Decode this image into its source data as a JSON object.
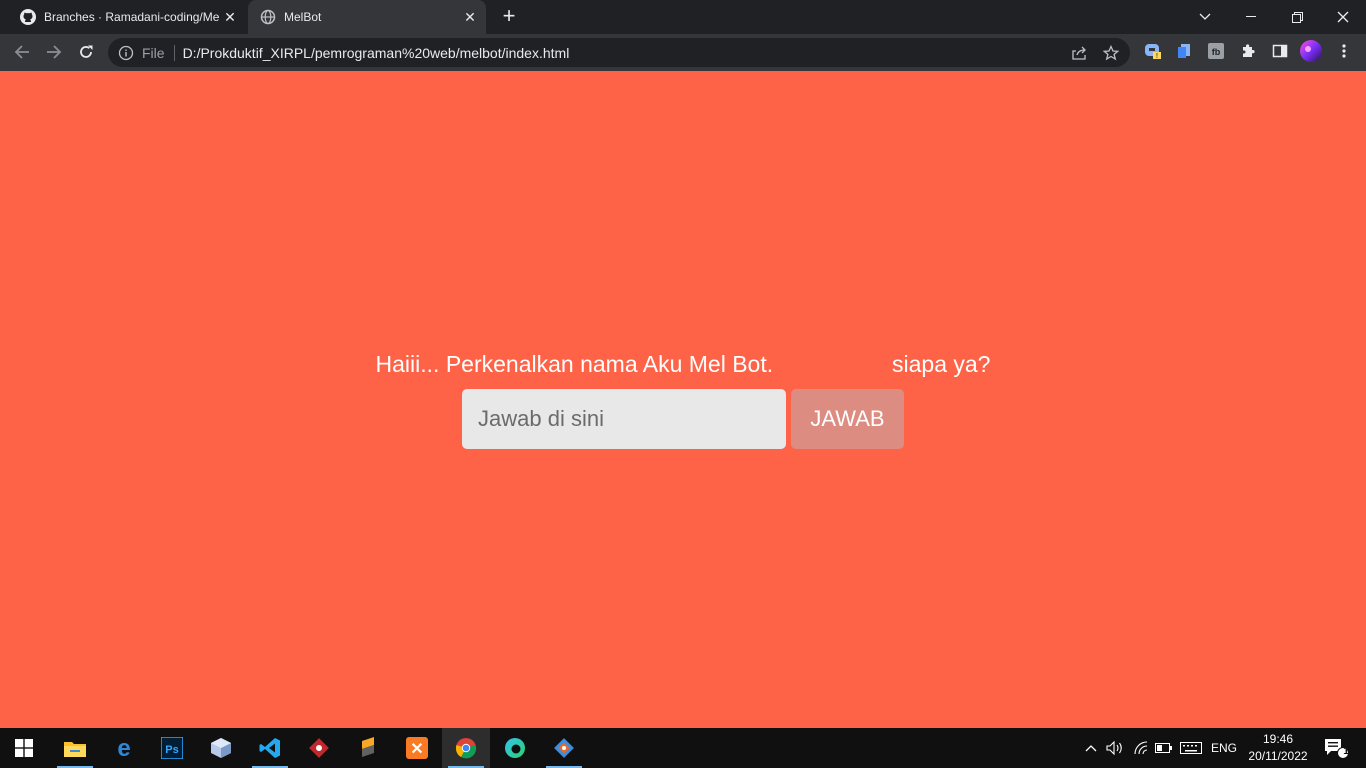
{
  "browser": {
    "tabs": [
      {
        "title": "Branches · Ramadani-coding/Mel",
        "icon": "github-icon"
      },
      {
        "title": "MelBot",
        "icon": "globe-icon"
      }
    ],
    "new_tab_label": "+",
    "omnibox": {
      "scheme_label": "File",
      "url": "D:/Prokduktif_XIRPL/pemrograman%20web/melbot/index.html"
    }
  },
  "page": {
    "question_visible_start": "Haiii... Perkenalkan nama Aku Mel Bot.",
    "question_visible_end": "siapa ya?",
    "input_placeholder": "Jawab di sini",
    "button_label": "JAWAB",
    "background_color": "#ff6347",
    "button_color": "#dc8c80"
  },
  "taskbar": {
    "apps": [
      "windows-start",
      "file-explorer",
      "edge-legacy",
      "photoshop",
      "virtualbox",
      "vscode",
      "git-client",
      "sublime-merge",
      "xampp",
      "chrome",
      "edge",
      "git-extension"
    ],
    "language": "ENG",
    "time": "19:46",
    "date": "20/11/2022",
    "notification_count": "1"
  }
}
